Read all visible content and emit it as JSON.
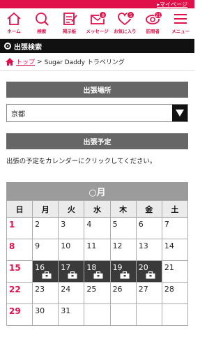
{
  "header": {
    "mypage_label": "▸マイページ"
  },
  "nav": {
    "items": [
      {
        "label": "ホーム",
        "icon": "home-icon"
      },
      {
        "label": "検索",
        "icon": "search-icon"
      },
      {
        "label": "掲示板",
        "icon": "bulletin-board-icon"
      },
      {
        "label": "メッセージ",
        "icon": "mail-icon",
        "badge": "8"
      },
      {
        "label": "お気に入り",
        "icon": "heart-icon",
        "badge": "5"
      },
      {
        "label": "訪問者",
        "icon": "footprint-icon",
        "badge": "21"
      },
      {
        "label": "メニュー",
        "icon": "menu-icon"
      }
    ]
  },
  "page": {
    "section_title": "出張検索",
    "breadcrumb": {
      "home_link": "トップ",
      "separator": ">",
      "current": "Sugar Daddy トラベリング"
    }
  },
  "form": {
    "location_heading": "出張場所",
    "location_value": "京都",
    "schedule_heading": "出張予定",
    "instruction": "出張の予定をカレンダーにクリックしてください。"
  },
  "calendar": {
    "month_label": "○月",
    "weekdays": [
      "日",
      "月",
      "火",
      "水",
      "木",
      "金",
      "土"
    ],
    "weeks": [
      [
        "1",
        "2",
        "3",
        "4",
        "5",
        "6",
        "7"
      ],
      [
        "8",
        "9",
        "10",
        "11",
        "12",
        "13",
        "14"
      ],
      [
        "15",
        "16",
        "17",
        "18",
        "19",
        "20",
        "21"
      ],
      [
        "22",
        "23",
        "24",
        "25",
        "26",
        "27",
        "28"
      ],
      [
        "29",
        "30",
        "31",
        "",
        "",
        "",
        ""
      ]
    ],
    "booked_days": [
      "16",
      "17",
      "18",
      "19",
      "20"
    ],
    "colors": {
      "accent": "#e0104a",
      "booked": "#3a3a3a",
      "header": "#9b9b9b"
    }
  }
}
